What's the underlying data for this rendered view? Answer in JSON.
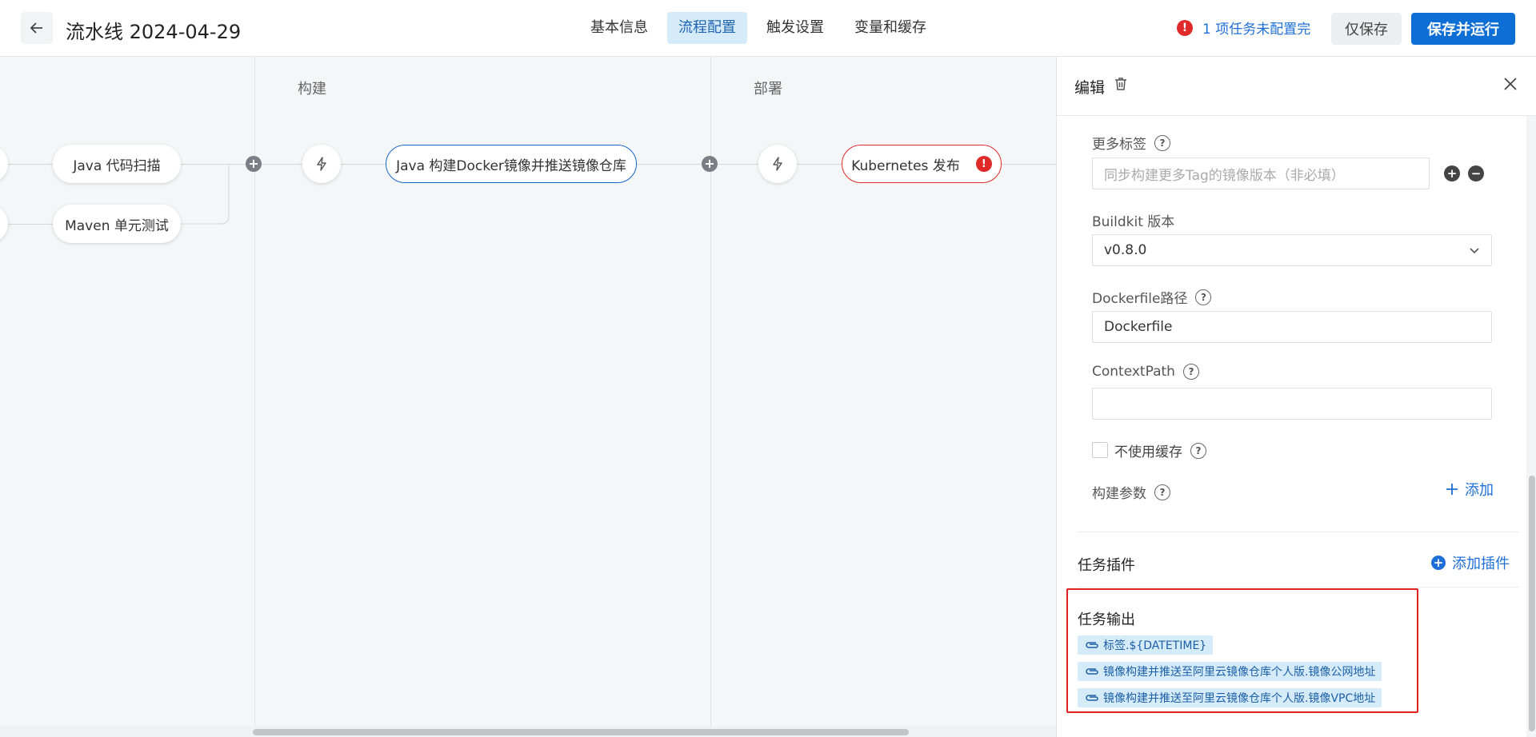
{
  "header": {
    "title": "流水线 2024-04-29",
    "tabs": [
      {
        "label": "基本信息"
      },
      {
        "label": "流程配置",
        "active": true
      },
      {
        "label": "触发设置"
      },
      {
        "label": "变量和缓存"
      }
    ],
    "warning_text": "1 项任务未配置完",
    "save_label": "仅保存",
    "save_run_label": "保存并运行"
  },
  "pipeline": {
    "stages": [
      {
        "label": "构建"
      },
      {
        "label": "部署"
      }
    ],
    "nodes": {
      "java_scan": "Java 代码扫描",
      "maven_test": "Maven 单元测试",
      "docker_build": "Java 构建Docker镜像并推送镜像仓库",
      "k8s_deploy": "Kubernetes 发布"
    }
  },
  "panel": {
    "title": "编辑",
    "fields": {
      "more_tags": {
        "label": "更多标签",
        "placeholder": "同步构建更多Tag的镜像版本（非必填）"
      },
      "buildkit": {
        "label": "Buildkit 版本",
        "value": "v0.8.0"
      },
      "dockerfile": {
        "label": "Dockerfile路径",
        "value": "Dockerfile"
      },
      "context_path": {
        "label": "ContextPath",
        "value": ""
      },
      "no_cache": {
        "label": "不使用缓存",
        "checked": false
      },
      "build_args": {
        "label": "构建参数",
        "add_label": "添加"
      }
    },
    "plugins": {
      "title": "任务插件",
      "add_label": "添加插件"
    },
    "outputs": {
      "title": "任务输出",
      "items": [
        "标签.${DATETIME}",
        "镜像构建并推送至阿里云镜像仓库个人版.镜像公网地址",
        "镜像构建并推送至阿里云镜像仓库个人版.镜像VPC地址"
      ]
    }
  },
  "colors": {
    "primary": "#0d6fd6",
    "error": "#e02a2a",
    "active_tab_bg": "#d6ebfa"
  }
}
